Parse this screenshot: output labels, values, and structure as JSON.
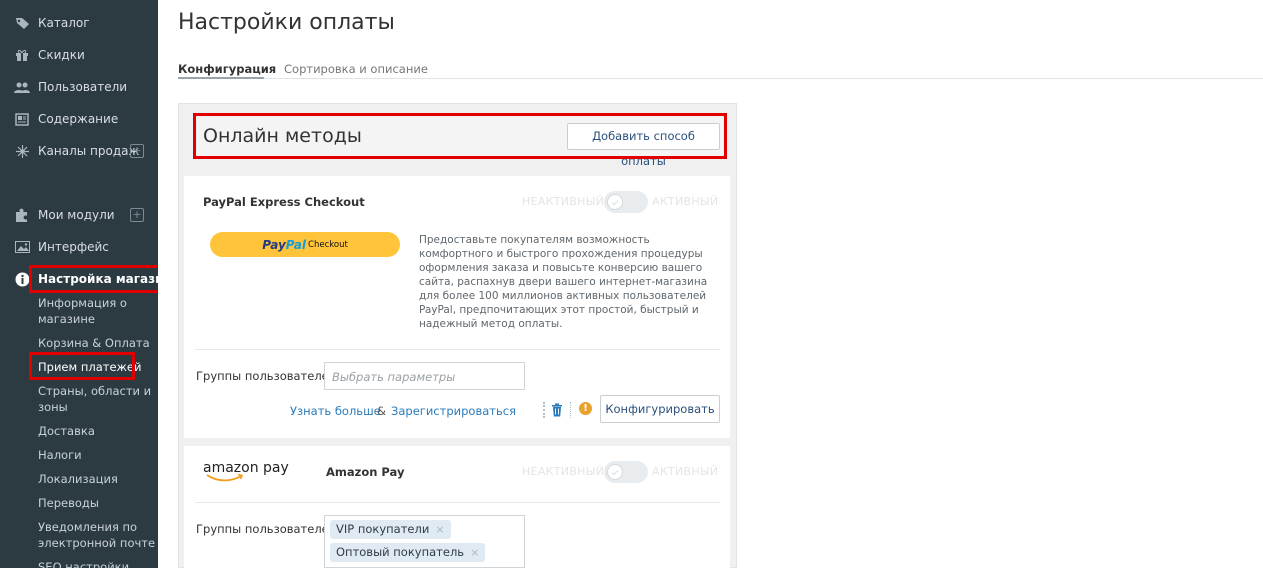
{
  "sidebar": {
    "items": [
      {
        "label": "Каталог",
        "icon": "tag-icon"
      },
      {
        "label": "Скидки",
        "icon": "gift-icon"
      },
      {
        "label": "Пользователи",
        "icon": "users-icon"
      },
      {
        "label": "Содержание",
        "icon": "document-icon"
      },
      {
        "label": "Каналы продаж",
        "icon": "network-icon",
        "plus": "+"
      },
      {
        "label": "Мои модули",
        "icon": "puzzle-icon",
        "plus": "+"
      },
      {
        "label": "Интерфейс",
        "icon": "image-icon"
      },
      {
        "label": "Настройка магазина",
        "icon": "info-icon"
      }
    ],
    "subitems": [
      "Информация о магазине",
      "Корзина & Оплата",
      "Прием платежей",
      "Страны, области и зоны",
      "Доставка",
      "Налоги",
      "Локализация",
      "Переводы",
      "Уведомления по электронной почте",
      "SEO настройки"
    ]
  },
  "page": {
    "title": "Настройки оплаты",
    "tabs": [
      "Конфигурация",
      "Сортировка и описание"
    ]
  },
  "section": {
    "title": "Онлайн методы",
    "add_button": "Добавить способ оплаты"
  },
  "paypal": {
    "name": "PayPal Express Checkout",
    "inactive": "НЕАКТИВНЫЙ",
    "active": "АКТИВНЫЙ",
    "logo_pay": "Pay",
    "logo_pal": "Pal",
    "logo_checkout": "Checkout",
    "description": "Предоставьте покупателям возможность комфортного и быстрого прохождения процедуры оформления заказа и повысьте конверсию вашего сайта, распахнув двери вашего интернет-магазина для более 100 миллионов активных пользователей PayPal, предпочитающих этот простой, быстрый и надежный метод оплаты.",
    "groups_label": "Группы пользователей",
    "groups_placeholder": "Выбрать параметры",
    "learn_more": "Узнать больше",
    "amp": "&",
    "register": "Зарегистрироваться",
    "configure": "Конфигурировать"
  },
  "amazon": {
    "logo": "amazon pay",
    "name": "Amazon Pay",
    "inactive": "НЕАКТИВНЫЙ",
    "active": "АКТИВНЫЙ",
    "groups_label": "Группы пользователей",
    "chips": [
      "VIP покупатели",
      "Оптовый покупатель"
    ],
    "chip_remove": "×"
  },
  "colors": {
    "sidebar_bg": "#2c3a42",
    "highlight": "#e00000",
    "paypal_yellow": "#ffc439",
    "link": "#2b7bba"
  }
}
